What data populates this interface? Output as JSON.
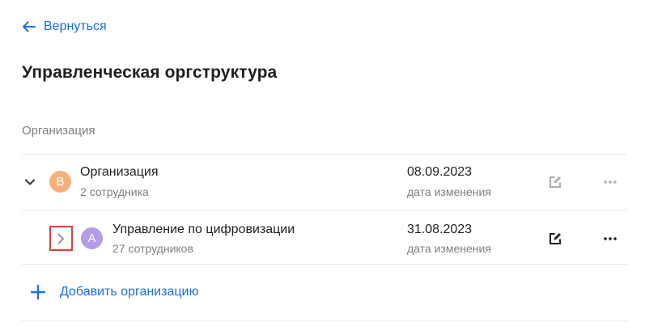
{
  "back": {
    "label": "Вернуться"
  },
  "page": {
    "title": "Управленческая оргструктура"
  },
  "section": {
    "label": "Организация"
  },
  "rows": [
    {
      "avatar_letter": "В",
      "avatar_color": "#f5b07c",
      "name": "Организация",
      "employees": "2 сотрудника",
      "date": "08.09.2023",
      "date_label": "дата изменения",
      "expanded": true,
      "actions_enabled": false
    },
    {
      "avatar_letter": "А",
      "avatar_color": "#b69bea",
      "name": "Управление по цифровизации",
      "employees": "27 сотрудников",
      "date": "31.08.2023",
      "date_label": "дата изменения",
      "expanded": false,
      "actions_enabled": true
    }
  ],
  "add": {
    "label": "Добавить организацию"
  },
  "colors": {
    "accent": "#1a6ee6",
    "muted_text": "#7a7f87",
    "divider": "#e7e8ea",
    "highlight": "#e23b3b",
    "disabled_icon": "#a9adb3",
    "enabled_icon": "#1f1f1f"
  },
  "icons": {
    "back": "arrow-left-icon",
    "collapse": "chevron-down-icon",
    "expand": "chevron-right-icon",
    "edit": "edit-icon",
    "more": "more-horizontal-icon",
    "add": "plus-icon"
  }
}
